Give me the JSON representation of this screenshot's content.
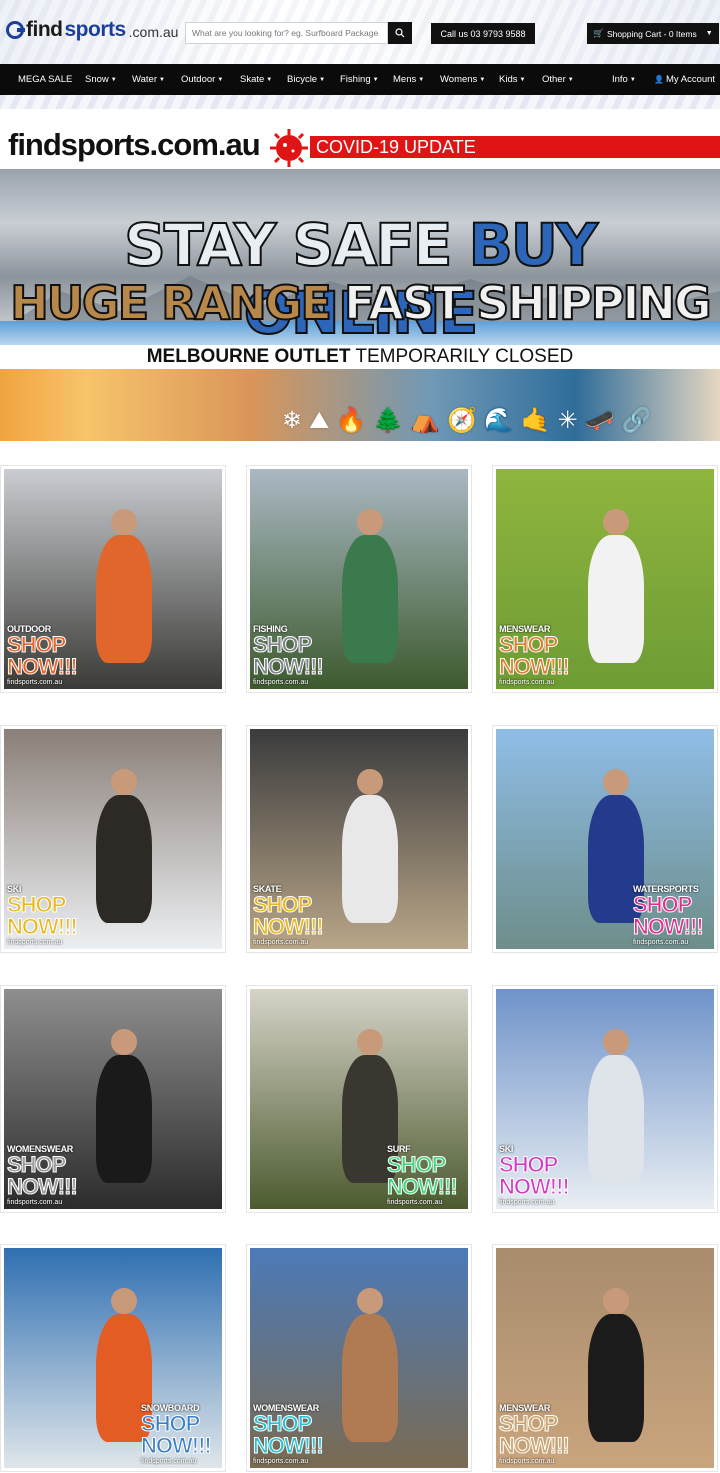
{
  "header": {
    "logo_find": "find",
    "logo_sports": "sports",
    "logo_domain": ".com.au",
    "search_placeholder": "What are you looking for? eg. Surfboard Package",
    "call_label": "Call us 03 9793 9588",
    "cart_label": "Shopping Cart - 0 Items"
  },
  "nav": {
    "items": [
      {
        "label": "MEGA SALE",
        "dropdown": false
      },
      {
        "label": "Snow",
        "dropdown": true
      },
      {
        "label": "Water",
        "dropdown": true
      },
      {
        "label": "Outdoor",
        "dropdown": true
      },
      {
        "label": "Skate",
        "dropdown": true
      },
      {
        "label": "Bicycle",
        "dropdown": true
      },
      {
        "label": "Fishing",
        "dropdown": true
      },
      {
        "label": "Mens",
        "dropdown": true
      },
      {
        "label": "Womens",
        "dropdown": true
      },
      {
        "label": "Kids",
        "dropdown": true
      },
      {
        "label": "Other",
        "dropdown": true
      }
    ],
    "info_label": "Info",
    "account_label": "My Account"
  },
  "banner": {
    "brand": "findsports.com.au",
    "covid": "COVID-19 UPDATE",
    "line1_a": "STAY SAFE ",
    "line1_b": "BUY ONLINE",
    "line2_a": "HUGE RANGE ",
    "line2_b": "FAST SHIPPING",
    "outlet_bold": "MELBOURNE OUTLET",
    "outlet_rest": " TEMPORARILY CLOSED"
  },
  "tiles": [
    {
      "category": "OUTDOOR",
      "shop": "SHOP",
      "now": "NOW!!!",
      "site": "findsports.com.au",
      "accent": "#e8632a",
      "bg_top": "#c9cdd1",
      "bg_bottom": "#3b3a36",
      "figure": "#e0662b"
    },
    {
      "category": "FISHING",
      "shop": "SHOP",
      "now": "NOW!!!",
      "site": "findsports.com.au",
      "accent": "#7d8388",
      "bg_top": "#aab8c3",
      "bg_bottom": "#3d5a2e",
      "figure": "#3a7a4d"
    },
    {
      "category": "MENSWEAR",
      "shop": "SHOP",
      "now": "NOW!!!",
      "site": "findsports.com.au",
      "accent": "#e07a2c",
      "bg_top": "#8fb53e",
      "bg_bottom": "#6e9c34",
      "figure": "#f2f2f2"
    },
    {
      "category": "SKI",
      "shop": "SHOP",
      "now": "NOW!!!",
      "site": "findsports.com.au",
      "accent": "#e8b81c",
      "bg_top": "#8a7f78",
      "bg_bottom": "#eceff2",
      "figure": "#2d2a26"
    },
    {
      "category": "SKATE",
      "shop": "SHOP",
      "now": "NOW!!!",
      "site": "findsports.com.au",
      "accent": "#e8b81c",
      "bg_top": "#3b3b3d",
      "bg_bottom": "#b9a688",
      "figure": "#e8e8e8"
    },
    {
      "category": "WATERSPORTS",
      "shop": "SHOP",
      "now": "NOW!!!",
      "site": "findsports.com.au",
      "accent": "#e02f8f",
      "bg_top": "#8fbde6",
      "bg_bottom": "#6d8e8a",
      "figure": "#243a8c"
    },
    {
      "category": "WOMENSWEAR",
      "shop": "SHOP",
      "now": "NOW!!!",
      "site": "findsports.com.au",
      "accent": "#9a9a9a",
      "bg_top": "#8e8e8e",
      "bg_bottom": "#2c2c2c",
      "figure": "#1a1a1a"
    },
    {
      "category": "SURF",
      "shop": "SHOP",
      "now": "NOW!!!",
      "site": "findsports.com.au",
      "accent": "#3fd67a",
      "bg_top": "#d6d3c8",
      "bg_bottom": "#4c5b2f",
      "figure": "#3a3630"
    },
    {
      "category": "SKI",
      "shop": "SHOP",
      "now": "NOW!!!",
      "site": "findsports.com.au",
      "accent": "#d43ac0",
      "bg_top": "#6f93c9",
      "bg_bottom": "#e9eef3",
      "figure": "#dfe4ea"
    },
    {
      "category": "SNOWBOARD",
      "shop": "SHOP",
      "now": "NOW!!!",
      "site": "findsports.com.au",
      "accent": "#3c7fc4",
      "bg_top": "#2f6fb1",
      "bg_bottom": "#dfe6ea",
      "figure": "#e35c24"
    },
    {
      "category": "WOMENSWEAR",
      "shop": "SHOP",
      "now": "NOW!!!",
      "site": "findsports.com.au",
      "accent": "#29c1d1",
      "bg_top": "#4c7ab8",
      "bg_bottom": "#7a6b52",
      "figure": "#b07a52"
    },
    {
      "category": "MENSWEAR",
      "shop": "SHOP",
      "now": "NOW!!!",
      "site": "findsports.com.au",
      "accent": "#caa56f",
      "bg_top": "#a88c6e",
      "bg_bottom": "#c9a57d",
      "figure": "#1b1b1b"
    }
  ]
}
